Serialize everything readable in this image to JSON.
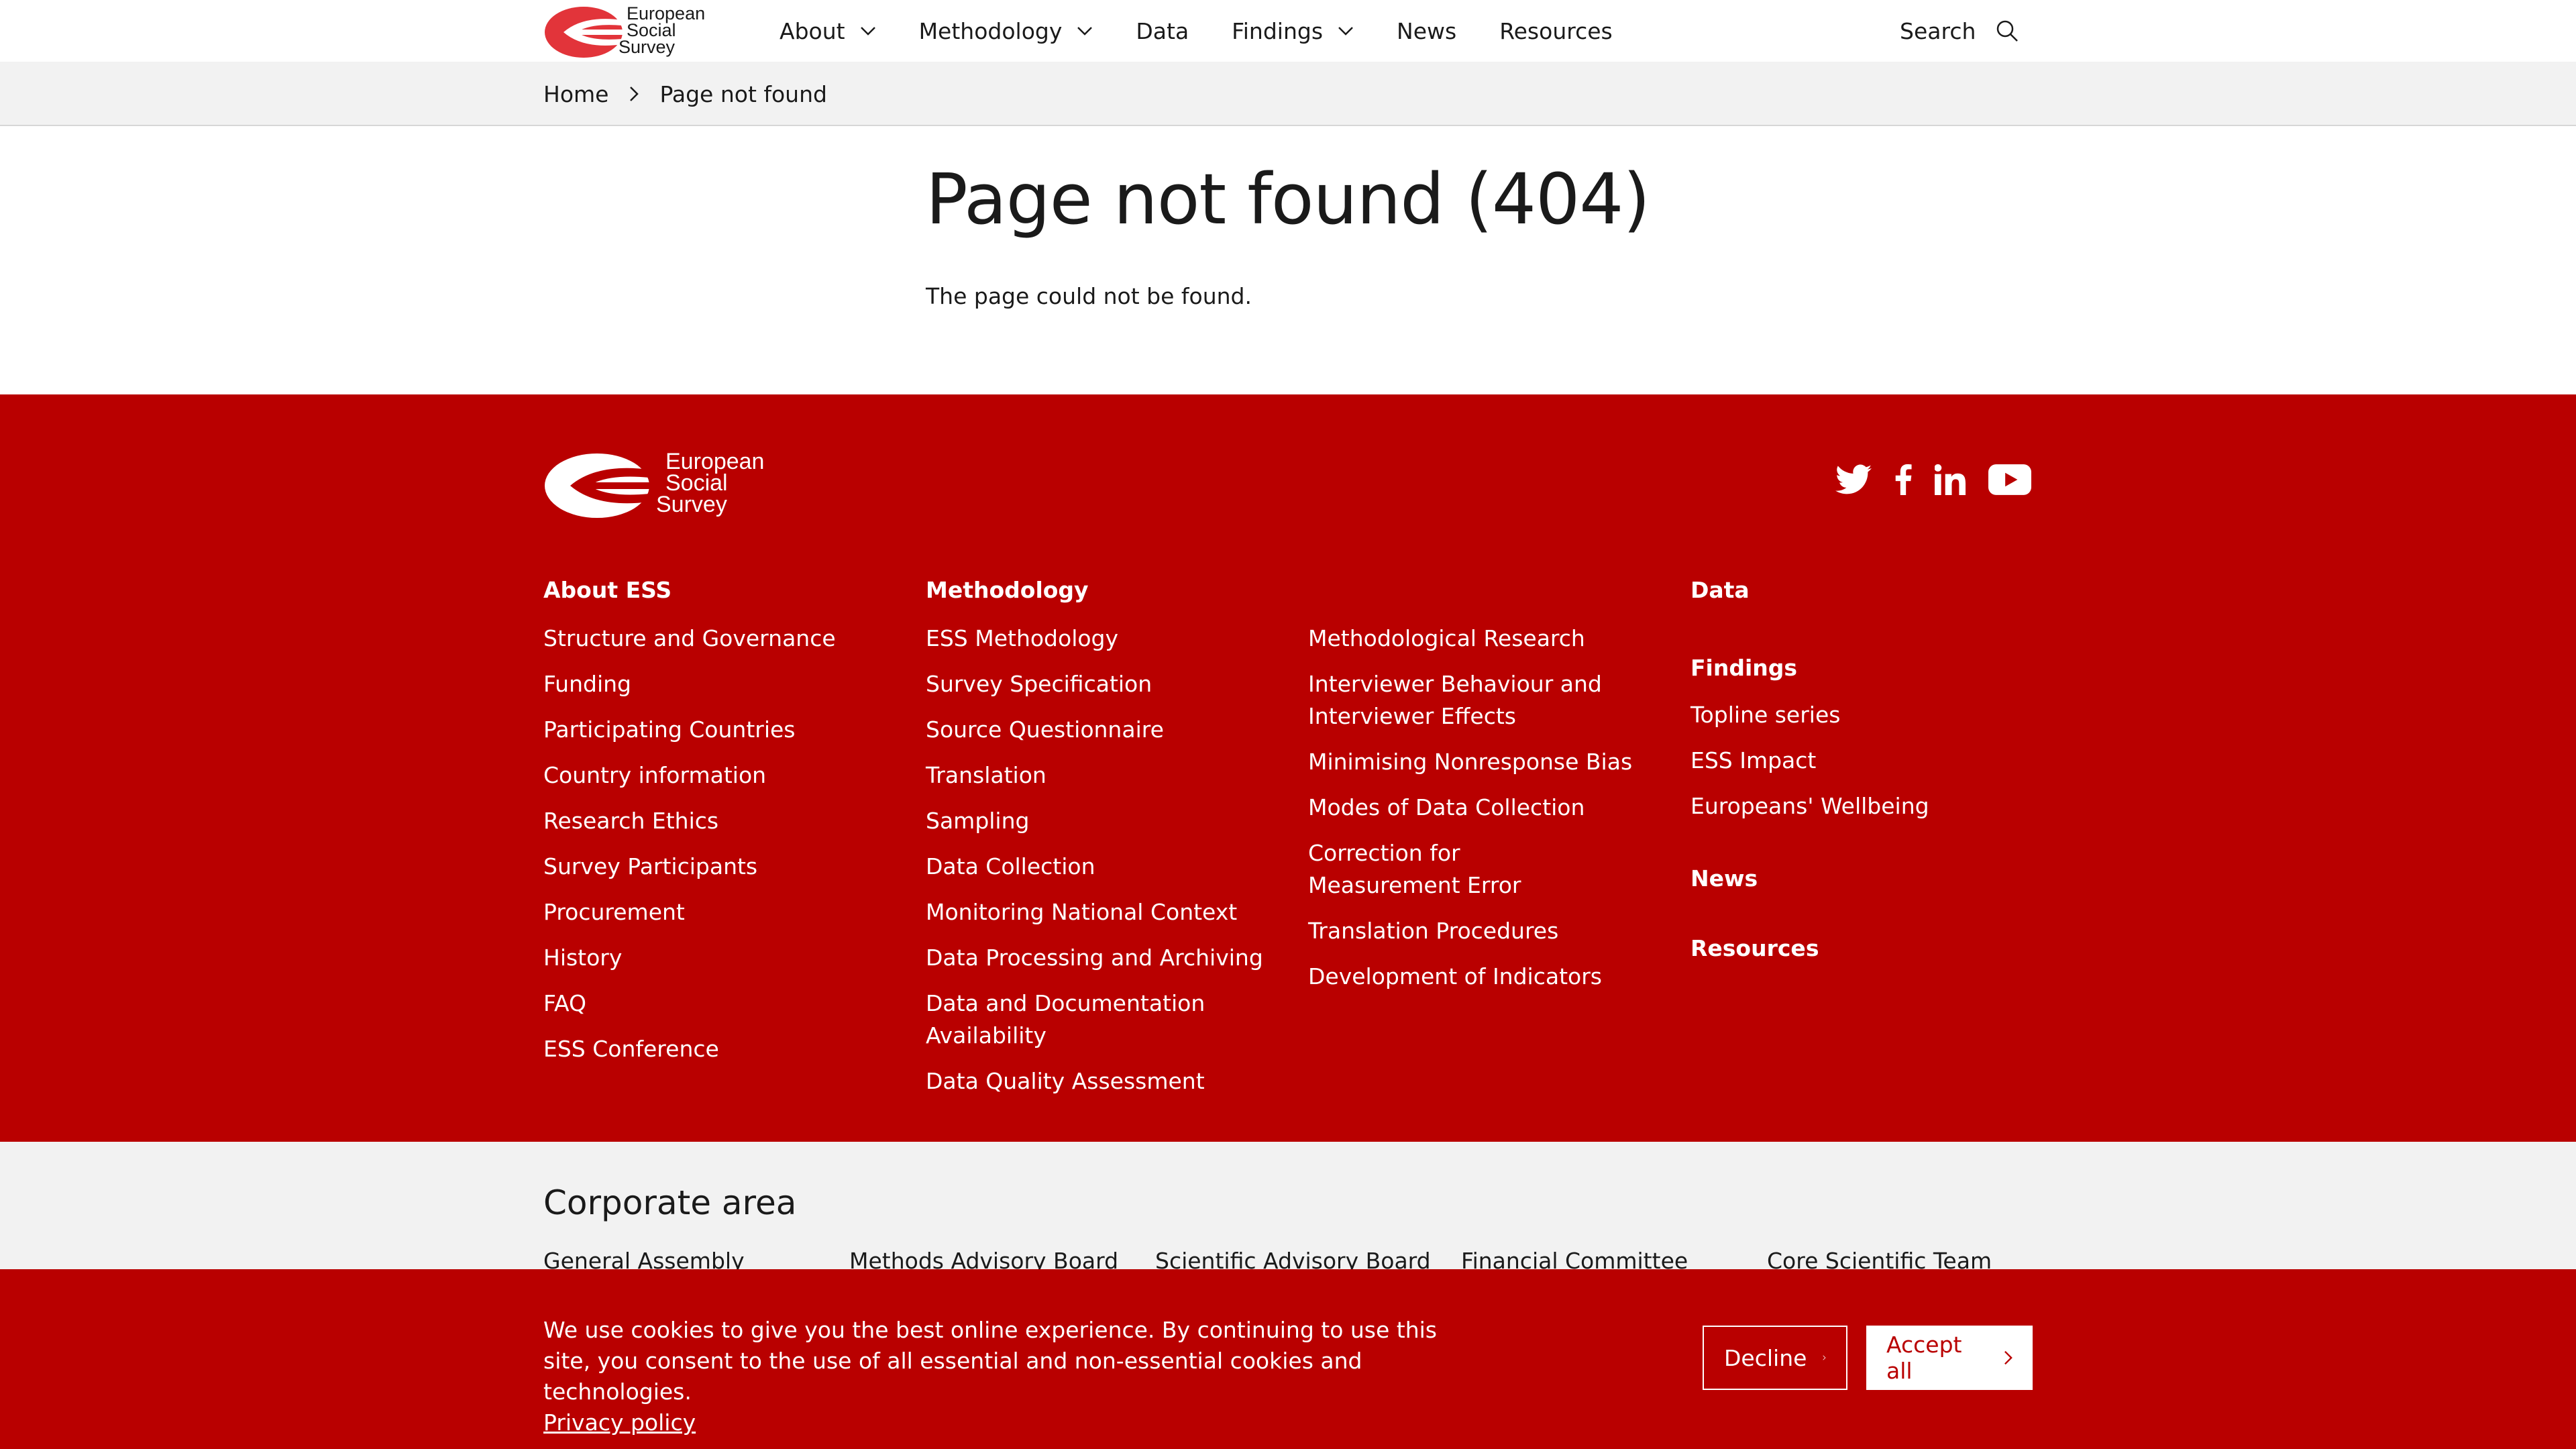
{
  "header": {
    "logo_text": "European Social Survey",
    "nav": [
      {
        "label": "About",
        "dropdown": true
      },
      {
        "label": "Methodology",
        "dropdown": true
      },
      {
        "label": "Data",
        "dropdown": false
      },
      {
        "label": "Findings",
        "dropdown": true
      },
      {
        "label": "News",
        "dropdown": false
      },
      {
        "label": "Resources",
        "dropdown": false
      }
    ],
    "search_label": "Search",
    "search_icon": "search-icon"
  },
  "breadcrumb": {
    "home": "Home",
    "current": "Page not found"
  },
  "main": {
    "title": "Page not found (404)",
    "message": "The page could not be found."
  },
  "footer": {
    "logo_text": "European Social Survey",
    "social": [
      "twitter-icon",
      "facebook-icon",
      "linkedin-icon",
      "youtube-icon"
    ],
    "about": {
      "heading": "About ESS",
      "links": [
        "Structure and Governance",
        "Funding",
        "Participating Countries",
        "Country information",
        "Research Ethics",
        "Survey Participants",
        "Procurement",
        "History",
        "FAQ",
        "ESS Conference"
      ]
    },
    "methodology": {
      "heading": "Methodology",
      "links": [
        "ESS Methodology",
        "Survey Specification",
        "Source Questionnaire",
        "Translation",
        "Sampling",
        "Data Collection",
        "Monitoring National Context",
        "Data Processing and Archiving",
        "Data and Documentation Availability",
        "Data Quality Assessment"
      ]
    },
    "methodology2": {
      "links": [
        "Methodological Research",
        "Interviewer Behaviour and Interviewer Effects",
        "Minimising Nonresponse Bias",
        "Modes of Data Collection",
        "Correction for Measurement Error",
        "Translation Procedures",
        "Development of Indicators"
      ]
    },
    "data_heading": "Data",
    "findings": {
      "heading": "Findings",
      "links": [
        "Topline series",
        "ESS Impact",
        "Europeans' Wellbeing"
      ]
    },
    "news_heading": "News",
    "resources_heading": "Resources"
  },
  "corporate": {
    "title": "Corporate area",
    "links": [
      "General Assembly",
      "Methods Advisory Board",
      "Scientific Advisory Board",
      "Financial Committee",
      "Core Scientific Team"
    ]
  },
  "cookie": {
    "text": "We use cookies to give you the best online experience. By continuing to use this site, you consent to the use of all essential and non-essential cookies and technologies.",
    "privacy_link": "Privacy policy",
    "decline": "Decline",
    "accept": "Accept all"
  },
  "colors": {
    "brand_red": "#b90000",
    "logo_red": "#e2343a",
    "light_grey": "#f2f2f2"
  }
}
